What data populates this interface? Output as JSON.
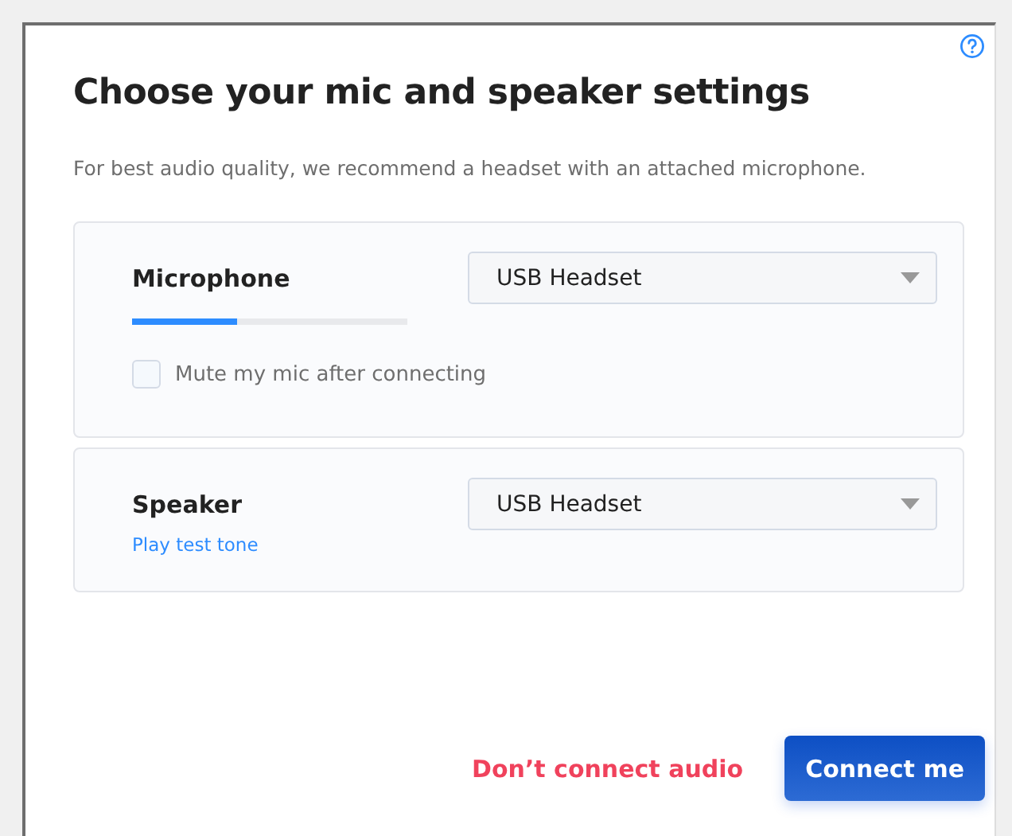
{
  "dialog": {
    "title": "Choose your mic and speaker settings",
    "subtitle": "For best audio quality, we recommend a headset with an attached microphone.",
    "devices": [
      {
        "kind": "microphone",
        "label": "Microphone",
        "device": "USB Headset",
        "level": 0.38,
        "option": {
          "label": "Mute my mic after connecting",
          "checked": false
        }
      },
      {
        "kind": "speaker",
        "label": "Speaker",
        "device": "USB Headset",
        "link": "Play test tone"
      }
    ],
    "buttons": [
      {
        "kind": "secondary",
        "label": "Don’t connect audio"
      },
      {
        "kind": "primary",
        "label": "Connect me"
      }
    ]
  }
}
